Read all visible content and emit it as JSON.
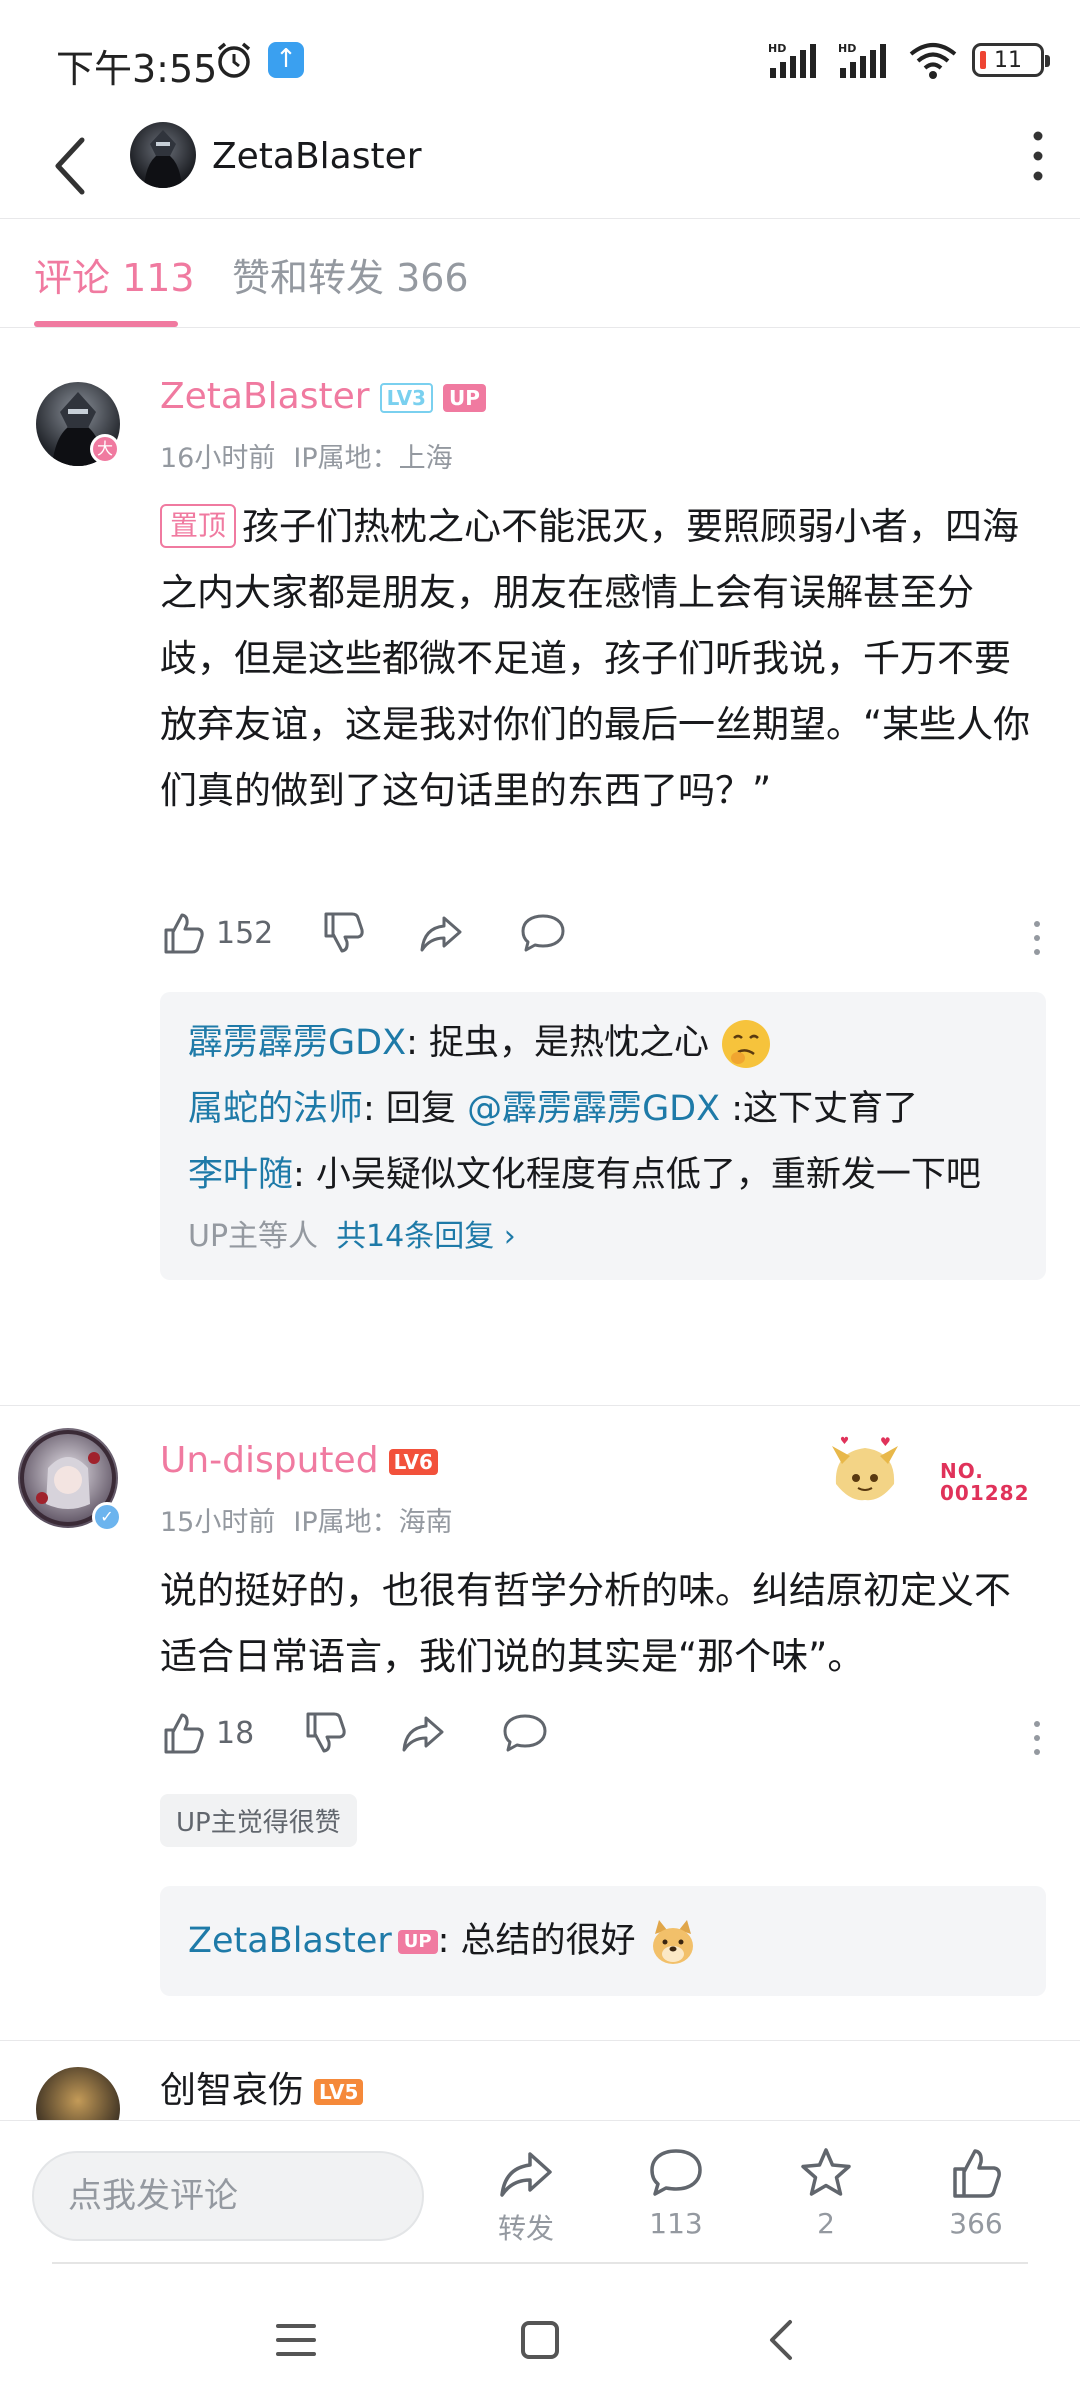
{
  "status_bar": {
    "time": "下午3:55",
    "battery": "11",
    "icons": [
      "alarm-icon",
      "app-upload-icon",
      "hd-signal-icon",
      "hd-signal-icon",
      "wifi-icon",
      "battery-icon"
    ]
  },
  "header": {
    "name": "ZetaBlaster",
    "back_icon": "chevron-left-icon",
    "more_icon": "more-vertical-icon"
  },
  "tabs": [
    {
      "label": "评论 113",
      "active": true
    },
    {
      "label": "赞和转发 366",
      "active": false
    }
  ],
  "comments": [
    {
      "user": "ZetaBlaster",
      "level": "LV3",
      "up_tag": "UP",
      "avatar_badge": "大",
      "time": "16小时前",
      "ip": "IP属地：上海",
      "pin_label": "置顶",
      "text": "孩子们热枕之心不能泯灭，要照顾弱小者，四海之内大家都是朋友，朋友在感情上会有误解甚至分歧，但是这些都微不足道，孩子们听我说，千万不要放弃友谊，这是我对你们的最后一丝期望。“某些人你们真的做到了这句话里的东西了吗？”",
      "likes": "152",
      "replies": [
        {
          "name": "霹雳霹雳GDX",
          "text": ": 捉虫，是热忱之心",
          "emoji": "thinking-emoji"
        },
        {
          "name": "属蛇的法师",
          "text": ": 回复 ",
          "mention": "@霹雳霹雳GDX",
          "text2": " :这下丈育了"
        },
        {
          "name": "李叶随",
          "text": ": 小吴疑似文化程度有点低了，重新发一下吧"
        }
      ],
      "reply_footer": "UP主等人",
      "reply_count_link": "共14条回复 ›"
    },
    {
      "user": "Un-disputed",
      "level": "LV6",
      "time": "15小时前",
      "ip": "IP属地：海南",
      "fan_badge_no": "NO.",
      "fan_badge_id": "001282",
      "text": "说的挺好的，也很有哲学分析的味。纠结原初定义不适合日常语言，我们说的其实是“那个味”。",
      "likes": "18",
      "liked_tag": "UP主觉得很赞",
      "replies": [
        {
          "name": "ZetaBlaster",
          "up_tag": "UP",
          "text": ": 总结的很好",
          "emoji": "doge-emoji"
        }
      ]
    },
    {
      "user": "创智哀伤",
      "level": "LV5"
    }
  ],
  "bottom_bar": {
    "input_placeholder": "点我发评论",
    "share_label": "转发",
    "comment_count": "113",
    "favorite_count": "2",
    "like_count": "366"
  },
  "colors": {
    "accent_pink": "#f07aa0",
    "reply_name_blue": "#1e7aa8",
    "muted_gray": "#9499a0"
  }
}
